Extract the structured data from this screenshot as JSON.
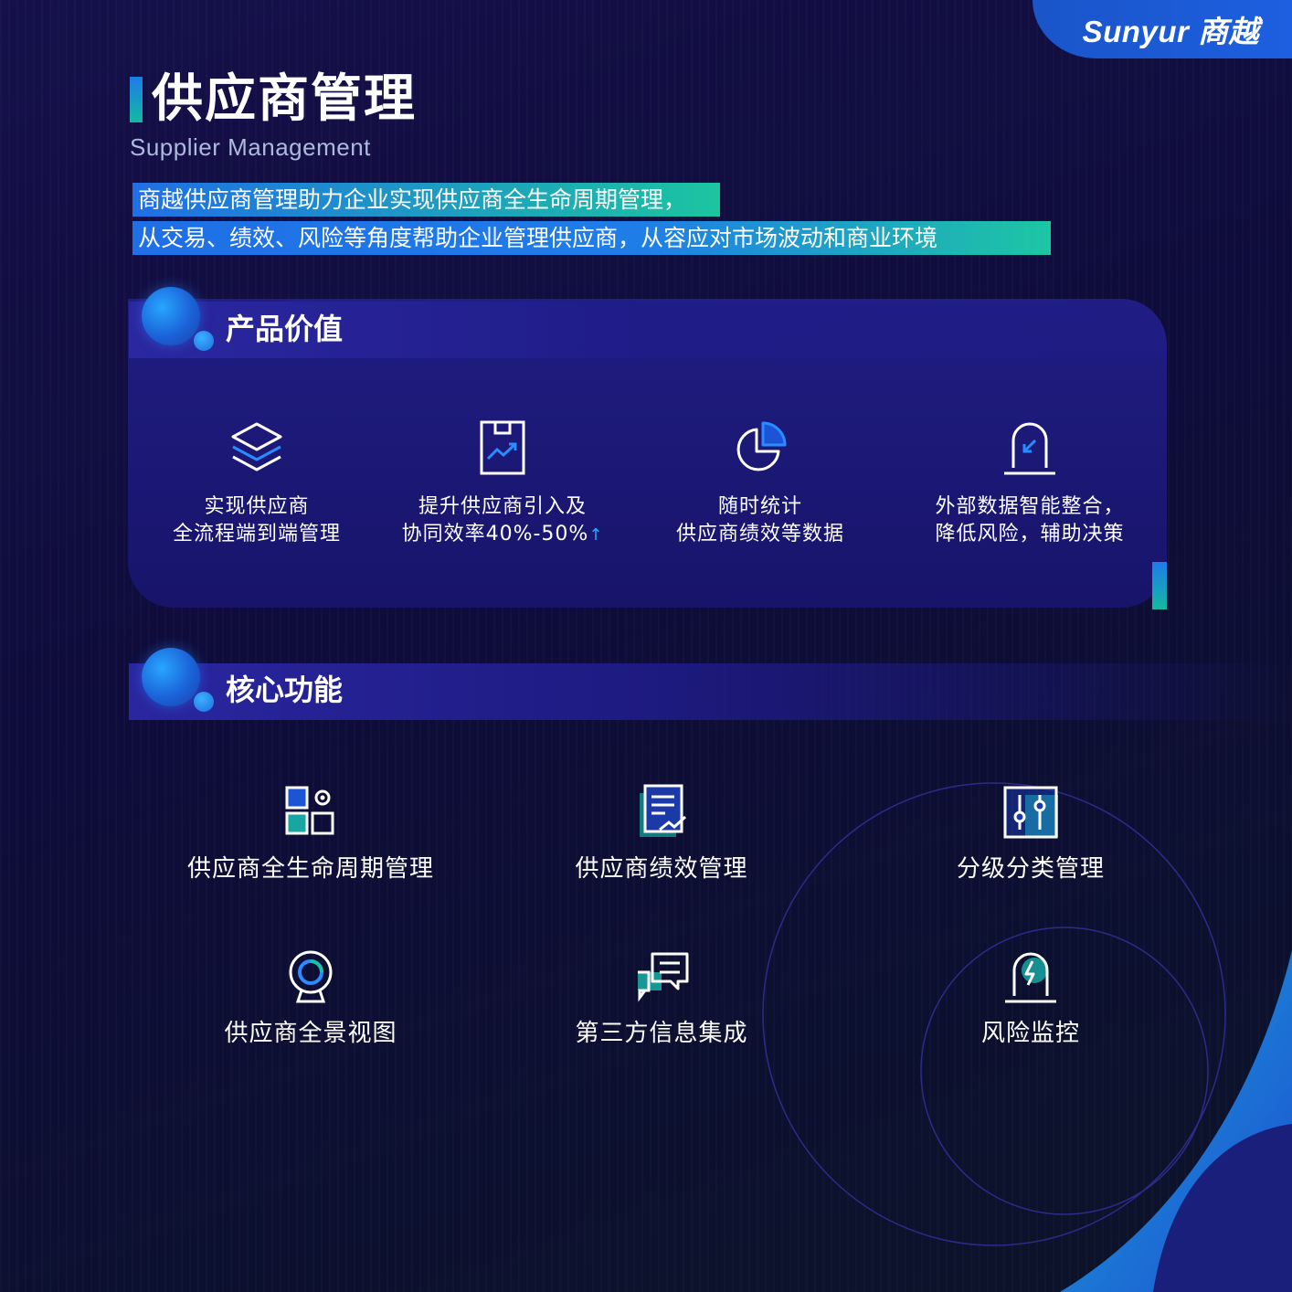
{
  "brand": {
    "logo_text": "Sunyur 商越"
  },
  "header": {
    "title": "供应商管理",
    "subtitle": "Supplier Management",
    "intro_line1": "商越供应商管理助力企业实现供应商全生命周期管理，",
    "intro_line2": "从交易、绩效、风险等角度帮助企业管理供应商，从容应对市场波动和商业环境"
  },
  "product_value": {
    "title": "产品价值",
    "items": [
      {
        "line1": "实现供应商",
        "line2": "全流程端到端管理",
        "icon": "layers-icon"
      },
      {
        "line1": "提升供应商引入及",
        "line2": "协同效率40%-50%",
        "suffix": "↑",
        "icon": "trend-document-icon"
      },
      {
        "line1": "随时统计",
        "line2": "供应商绩效等数据",
        "icon": "pie-chart-icon"
      },
      {
        "line1": "外部数据智能整合，",
        "line2": "降低风险，辅助决策",
        "icon": "alert-lamp-icon"
      }
    ]
  },
  "core_functions": {
    "title": "核心功能",
    "items": [
      {
        "label": "供应商全生命周期管理",
        "icon": "app-grid-settings-icon"
      },
      {
        "label": "供应商绩效管理",
        "icon": "performance-report-icon"
      },
      {
        "label": "分级分类管理",
        "icon": "slider-control-icon"
      },
      {
        "label": "供应商全景视图",
        "icon": "panorama-camera-icon"
      },
      {
        "label": "第三方信息集成",
        "icon": "chat-integration-icon"
      },
      {
        "label": "风险监控",
        "icon": "risk-alarm-icon"
      }
    ]
  },
  "colors": {
    "background": "#110e44",
    "accent_blue": "#1f6fe6",
    "accent_teal": "#1cc5a0",
    "panel": "#1d1a7a"
  }
}
